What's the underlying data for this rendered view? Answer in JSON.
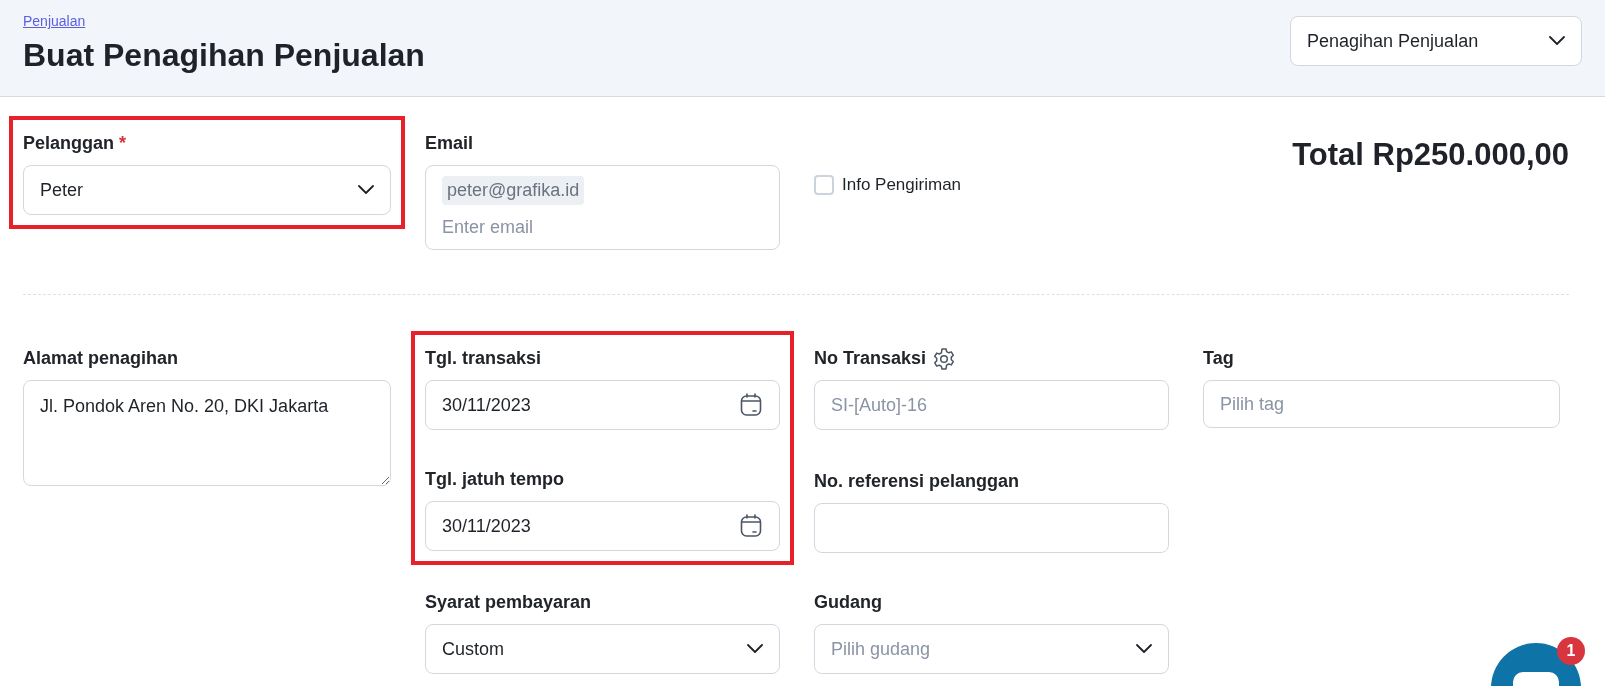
{
  "breadcrumb": "Penjualan",
  "title": "Buat Penagihan Penjualan",
  "type_select": {
    "value": "Penagihan Penjualan"
  },
  "total": "Total Rp250.000,00",
  "customer": {
    "label": "Pelanggan",
    "required_mark": "*",
    "value": "Peter",
    "highlighted": true
  },
  "email": {
    "label": "Email",
    "chips": [
      "peter@grafika.id"
    ],
    "placeholder": "Enter email"
  },
  "shipping_info": {
    "label": "Info Pengiriman",
    "checked": false
  },
  "billing_address": {
    "label": "Alamat penagihan",
    "value": "Jl. Pondok Aren No. 20, DKI Jakarta"
  },
  "dates": {
    "highlighted": true,
    "fields": [
      {
        "label": "Tgl. transaksi",
        "value": "30/11/2023"
      },
      {
        "label": "Tgl. jatuh tempo",
        "value": "30/11/2023"
      }
    ]
  },
  "payment_terms": {
    "label": "Syarat pembayaran",
    "value": "Custom"
  },
  "transaction_no": {
    "label": "No Transaksi",
    "placeholder": "SI-[Auto]-16"
  },
  "customer_ref": {
    "label": "No. referensi pelanggan"
  },
  "warehouse": {
    "label": "Gudang",
    "placeholder": "Pilih gudang"
  },
  "tag": {
    "label": "Tag",
    "placeholder": "Pilih tag"
  },
  "chat": {
    "badge": "1"
  }
}
